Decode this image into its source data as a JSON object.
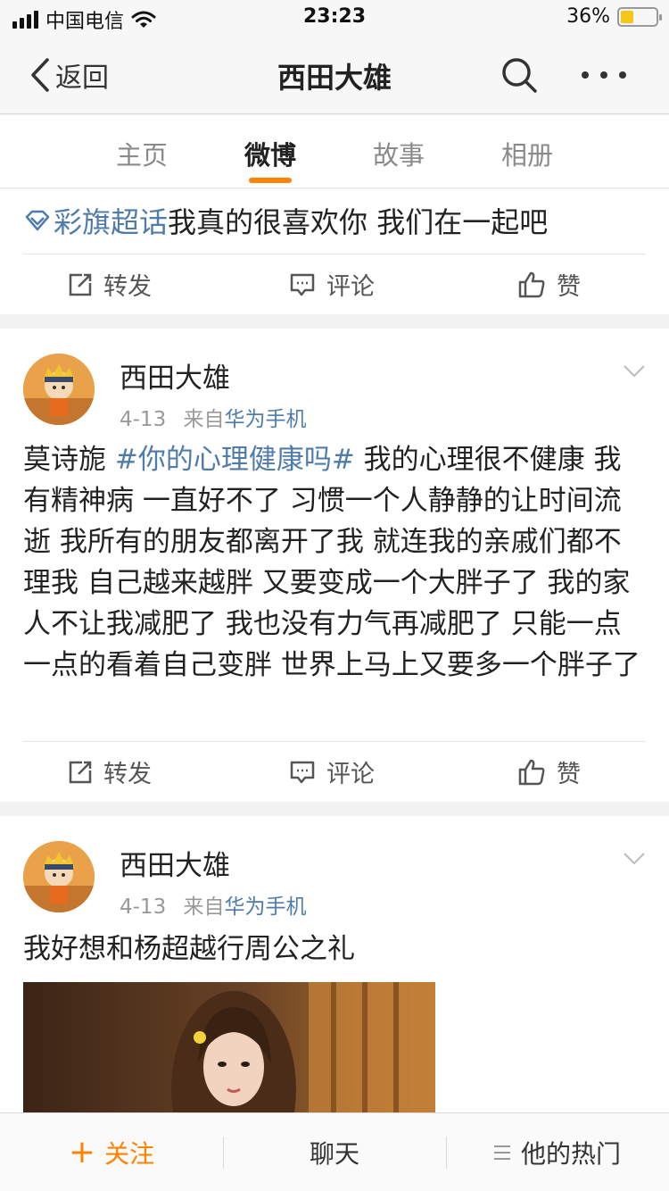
{
  "status_bar": {
    "carrier": "中国电信",
    "time": "23:23",
    "battery_percent": "36%",
    "battery_level": 0.36,
    "icons": [
      "signal-icon",
      "wifi-icon",
      "battery-icon"
    ]
  },
  "nav": {
    "back_label": "返回",
    "title": "西田大雄",
    "icons": [
      "chevron-left-icon",
      "search-icon",
      "more-icon"
    ]
  },
  "tabs": [
    {
      "label": "主页",
      "active": false
    },
    {
      "label": "微博",
      "active": true
    },
    {
      "label": "故事",
      "active": false
    },
    {
      "label": "相册",
      "active": false
    }
  ],
  "accent_color": "#ff8200",
  "link_color": "#4f7cab",
  "post1": {
    "topic": "彩旗超话",
    "text": "我真的很喜欢你 我们在一起吧",
    "actions": {
      "repost": "转发",
      "comment": "评论",
      "like": "赞"
    }
  },
  "post2": {
    "user": "西田大雄",
    "date": "4-13",
    "from_label": "来自",
    "source": "华为手机",
    "text_prefix": "莫诗旎 ",
    "hashtag": "#你的心理健康吗#",
    "text_body": " 我的心理很不健康 我有精神病 一直好不了 习惯一个人静静的让时间流逝 我所有的朋友都离开了我 就连我的亲戚们都不理我 自己越来越胖 又要变成一个大胖子了 我的家人不让我减肥了 我也没有力气再减肥了 只能一点一点的看着自己变胖 世界上马上又要多一个胖子了",
    "actions": {
      "repost": "转发",
      "comment": "评论",
      "like": "赞"
    }
  },
  "post3": {
    "user": "西田大雄",
    "date": "4-13",
    "from_label": "来自",
    "source": "华为手机",
    "text": "我好想和杨超越行周公之礼"
  },
  "bottom_bar": {
    "follow_label": "关注",
    "chat_label": "聊天",
    "hot_label": "他的热门"
  }
}
